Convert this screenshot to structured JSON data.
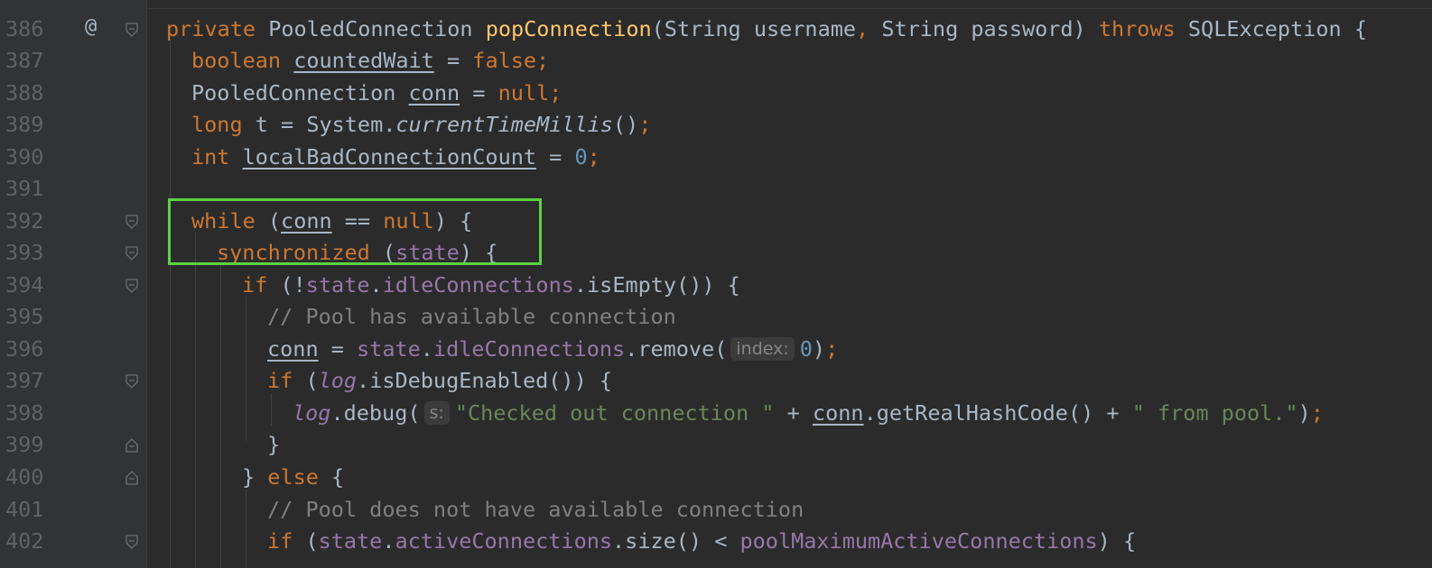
{
  "colors": {
    "background": "#2b2b2b",
    "gutter": "#313335",
    "line_number": "#606366",
    "keyword": "#cc7832",
    "method_decl": "#ffc66d",
    "field": "#9876aa",
    "number": "#6897bb",
    "string": "#6a8759",
    "comment": "#808080",
    "highlight_box": "#5bd341"
  },
  "gutter": {
    "override_icon": "@",
    "line_numbers": [
      "386",
      "387",
      "388",
      "389",
      "390",
      "391",
      "392",
      "393",
      "394",
      "395",
      "396",
      "397",
      "398",
      "399",
      "400",
      "401",
      "402"
    ]
  },
  "code": {
    "l386": {
      "kw_private": "private",
      "type": " PooledConnection ",
      "method": "popConnection",
      "params": "(String username",
      "comma": ",",
      "params2": " String password) ",
      "kw_throws": "throws",
      "exc": " SQLException {"
    },
    "l387": {
      "kw": "boolean",
      "sp": " ",
      "var": "countedWait",
      "eq": " = ",
      "val": "false",
      "semi": ";"
    },
    "l388": {
      "type": "PooledConnection ",
      "var": "conn",
      "eq": " = ",
      "val": "null",
      "semi": ";"
    },
    "l389": {
      "kw": "long",
      "rest": " t = System.",
      "method": "currentTimeMillis",
      "end": "()",
      "semi": ";"
    },
    "l390": {
      "kw": "int",
      "sp": " ",
      "var": "localBadConnectionCount",
      "eq": " = ",
      "num": "0",
      "semi": ";"
    },
    "l392": {
      "kw": "while",
      "open": " (",
      "var": "conn",
      "op": " == ",
      "val": "null",
      "close": ") {"
    },
    "l393": {
      "kw": "synchronized",
      "open": " (",
      "fld": "state",
      "close": ") {"
    },
    "l394": {
      "kw": "if",
      "open": " (!",
      "fld1": "state",
      "dot": ".",
      "fld2": "idleConnections",
      "rest": ".isEmpty()) {"
    },
    "l395": {
      "comment": "// Pool has available connection"
    },
    "l396": {
      "var": "conn",
      "eq": " = ",
      "fld1": "state",
      "dot": ".",
      "fld2": "idleConnections",
      "call": ".remove(",
      "hint": "index:",
      "num": "0",
      "close": ")",
      "semi": ";"
    },
    "l397": {
      "kw": "if",
      "open": " (",
      "fld": "log",
      "rest": ".isDebugEnabled()) {"
    },
    "l398": {
      "fld": "log",
      "call": ".debug(",
      "hint": "s:",
      "str1": "\"Checked out connection \"",
      "plus1": " + ",
      "var": "conn",
      "mid": ".getRealHashCode() + ",
      "str2": "\" from pool.\"",
      "close": ")",
      "semi": ";"
    },
    "l399": {
      "close": "}"
    },
    "l400": {
      "open": "} ",
      "kw": "else",
      "close": " {"
    },
    "l401": {
      "comment": "// Pool does not have available connection"
    },
    "l402": {
      "kw": "if",
      "open": " (",
      "fld1": "state",
      "dot": ".",
      "fld2": "activeConnections",
      "mid": ".size() < ",
      "fld3": "poolMaximumActiveConnections",
      "close": ") {"
    }
  }
}
